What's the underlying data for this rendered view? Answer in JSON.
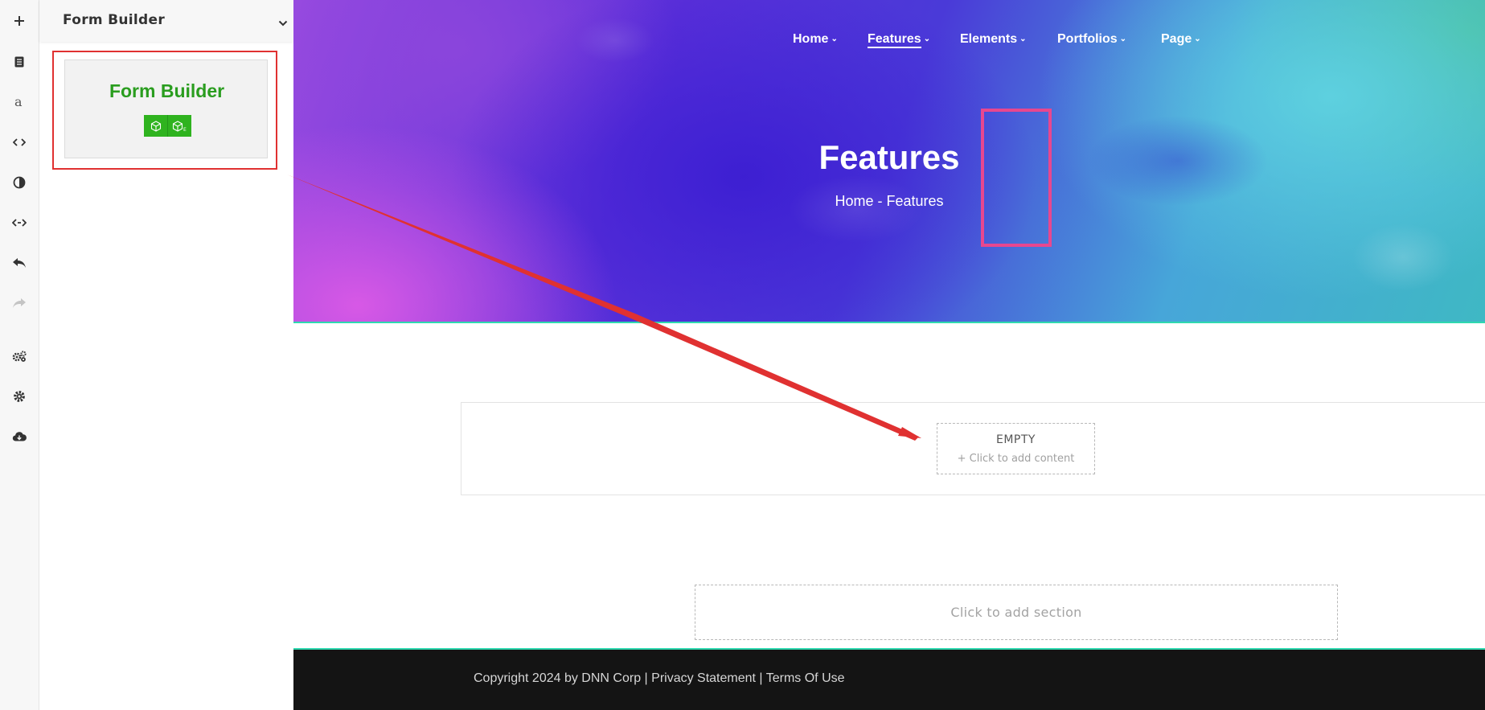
{
  "toolbar": {
    "items": [
      {
        "name": "add-icon"
      },
      {
        "name": "pages-icon"
      },
      {
        "name": "text-style-icon"
      },
      {
        "name": "code-icon"
      },
      {
        "name": "theme-contrast-icon"
      },
      {
        "name": "responsive-width-icon"
      },
      {
        "name": "undo-icon"
      },
      {
        "name": "redo-icon"
      },
      {
        "name": "advanced-settings-icon"
      },
      {
        "name": "settings-icon"
      },
      {
        "name": "cloud-download-icon"
      }
    ]
  },
  "panel": {
    "title": "Form Builder",
    "module": {
      "title": "Form Builder",
      "icons": [
        "cube-icon",
        "cube-edit-icon"
      ],
      "icon_badge": "E"
    }
  },
  "site": {
    "nav": [
      {
        "label": "Home",
        "active": false
      },
      {
        "label": "Features",
        "active": true
      },
      {
        "label": "Elements",
        "active": false
      },
      {
        "label": "Portfolios",
        "active": false
      },
      {
        "label": "Page",
        "active": false
      }
    ],
    "nav_caret": "⌄",
    "hero": {
      "title": "Features",
      "breadcrumb": "Home - Features"
    },
    "content": {
      "empty_title": "EMPTY",
      "empty_sub": "+ Click to add content",
      "add_section": "Click to add section"
    },
    "footer": {
      "copyright": "Copyright 2024 by DNN Corp",
      "separator_1": " | ",
      "privacy": "Privacy Statement",
      "separator_2": " | ",
      "terms": "Terms Of Use"
    }
  },
  "colors": {
    "annotation_red": "#e03131",
    "annotation_pink": "#e8478f",
    "module_green": "#2fb31f",
    "module_title_green": "#2a9d1f",
    "divider_teal": "#2fd9b0",
    "footer_bg": "#141414"
  }
}
